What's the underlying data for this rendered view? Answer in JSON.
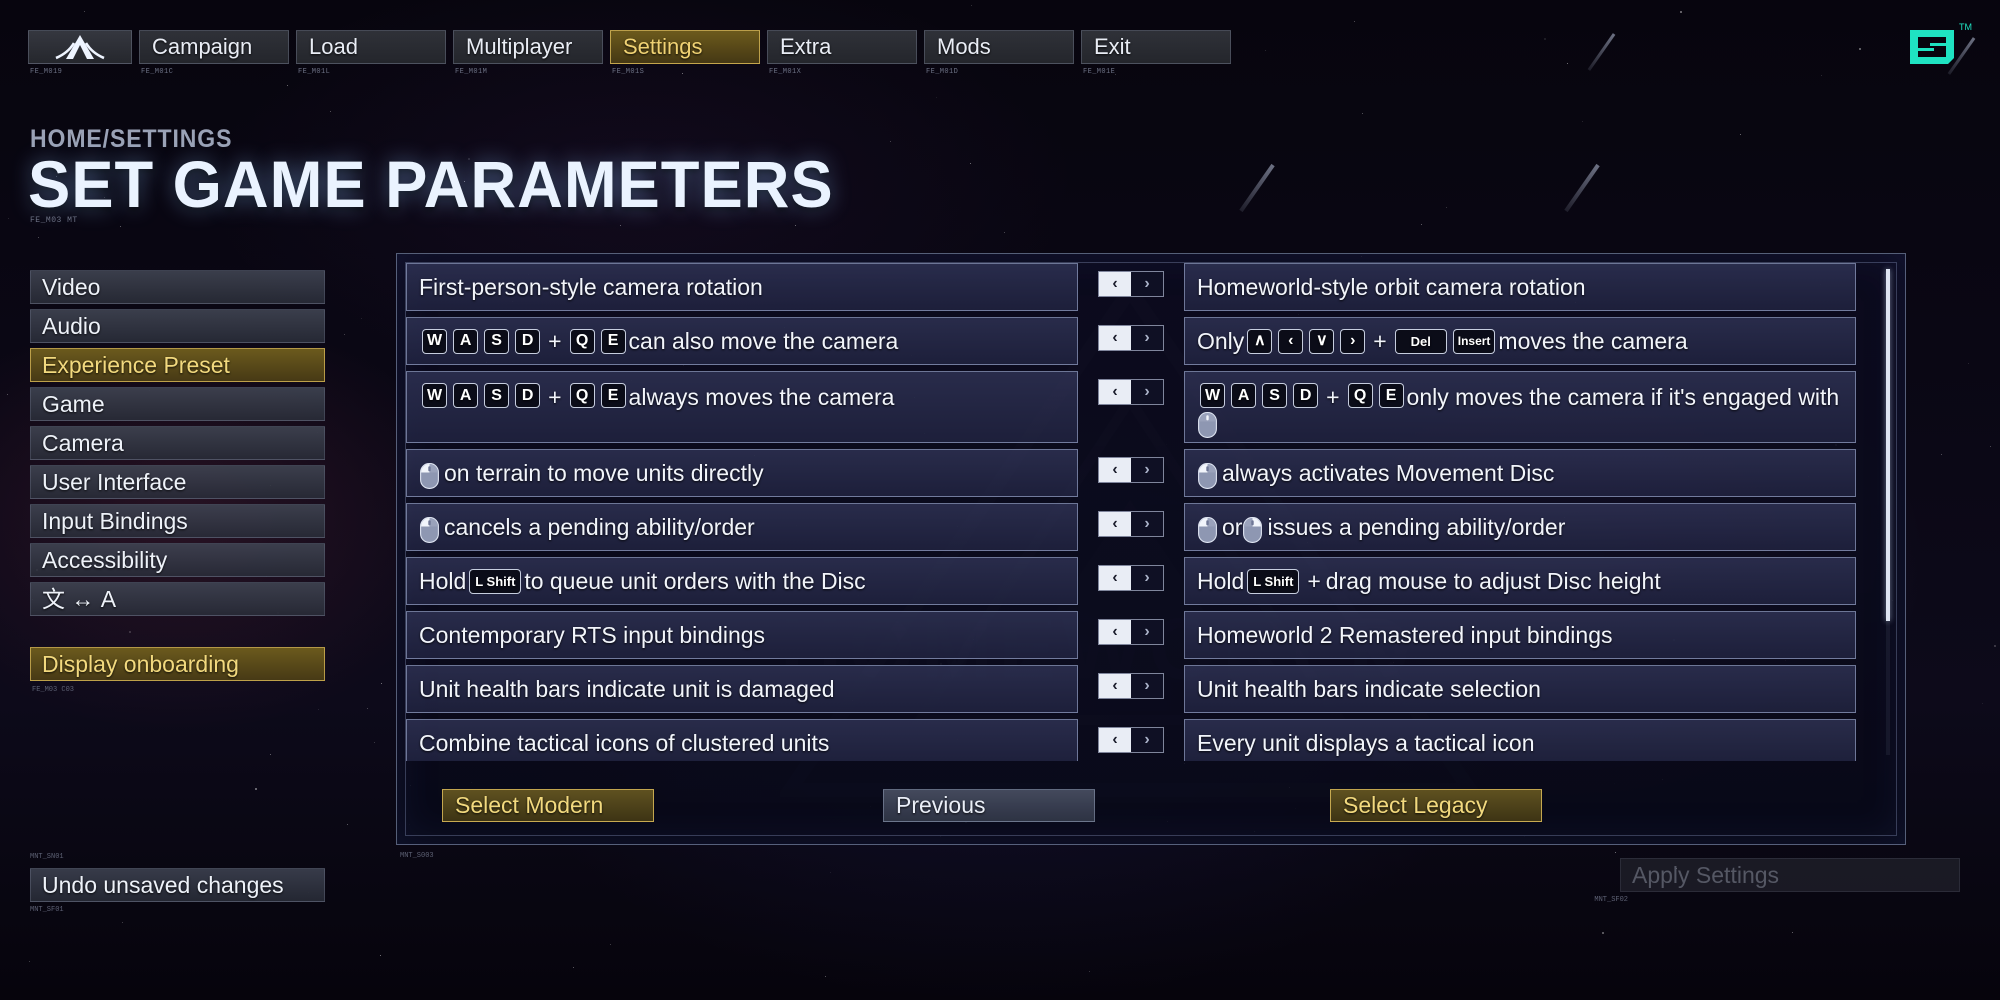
{
  "nav": {
    "logo_code": "FE_M019",
    "items": [
      {
        "label": "Campaign",
        "code": "FE_M01C",
        "active": false
      },
      {
        "label": "Load",
        "code": "FE_M01L",
        "active": false
      },
      {
        "label": "Multiplayer",
        "code": "FE_M01M",
        "active": false
      },
      {
        "label": "Settings",
        "code": "FE_M01S",
        "active": true
      },
      {
        "label": "Extra",
        "code": "FE_M01X",
        "active": false
      },
      {
        "label": "Mods",
        "code": "FE_M01D",
        "active": false
      },
      {
        "label": "Exit",
        "code": "FE_M01E",
        "active": false
      }
    ],
    "brand_tm": "TM"
  },
  "header": {
    "breadcrumb": "HOME/SETTINGS",
    "title": "SET GAME PARAMETERS",
    "code": "FE_M03 MT"
  },
  "sidebar": {
    "items": [
      {
        "label": "Video",
        "active": false
      },
      {
        "label": "Audio",
        "active": false
      },
      {
        "label": "Experience Preset",
        "active": true
      },
      {
        "label": "Game",
        "active": false
      },
      {
        "label": "Camera",
        "active": false
      },
      {
        "label": "User Interface",
        "active": false
      },
      {
        "label": "Input Bindings",
        "active": false
      },
      {
        "label": "Accessibility",
        "active": false
      },
      {
        "label": "文 ↔ A",
        "active": false
      }
    ],
    "onboarding": {
      "label": "Display onboarding",
      "code": "FE_M03 C03"
    }
  },
  "panel": {
    "rows": [
      {
        "left": {
          "segments": [
            {
              "t": "text",
              "v": "First-person-style camera rotation"
            }
          ]
        },
        "right": {
          "segments": [
            {
              "t": "text",
              "v": "Homeworld-style orbit camera rotation"
            }
          ]
        },
        "toggle": {
          "left_glyph": "‹",
          "right_glyph": "›",
          "selected": "left"
        },
        "tall": false
      },
      {
        "left": {
          "segments": [
            {
              "t": "key",
              "v": "W"
            },
            {
              "t": "key",
              "v": "A"
            },
            {
              "t": "key",
              "v": "S"
            },
            {
              "t": "key",
              "v": "D"
            },
            {
              "t": "plus",
              "v": "+"
            },
            {
              "t": "key",
              "v": "Q"
            },
            {
              "t": "key",
              "v": "E"
            },
            {
              "t": "text",
              "v": "can also move the camera"
            }
          ]
        },
        "right": {
          "segments": [
            {
              "t": "text",
              "v": "Only"
            },
            {
              "t": "key",
              "v": "∧"
            },
            {
              "t": "key",
              "v": "‹"
            },
            {
              "t": "key",
              "v": "∨"
            },
            {
              "t": "key",
              "v": "›"
            },
            {
              "t": "plus",
              "v": "+"
            },
            {
              "t": "key-wide",
              "v": "Del"
            },
            {
              "t": "key-sm",
              "v": "Insert"
            },
            {
              "t": "text",
              "v": "moves the camera"
            }
          ]
        },
        "toggle": {
          "left_glyph": "‹",
          "right_glyph": "›",
          "selected": "left"
        },
        "tall": false
      },
      {
        "left": {
          "segments": [
            {
              "t": "key",
              "v": "W"
            },
            {
              "t": "key",
              "v": "A"
            },
            {
              "t": "key",
              "v": "S"
            },
            {
              "t": "key",
              "v": "D"
            },
            {
              "t": "plus",
              "v": "+"
            },
            {
              "t": "key",
              "v": "Q"
            },
            {
              "t": "key",
              "v": "E"
            },
            {
              "t": "text",
              "v": "always moves the camera"
            }
          ]
        },
        "right": {
          "segments": [
            {
              "t": "key",
              "v": "W"
            },
            {
              "t": "key",
              "v": "A"
            },
            {
              "t": "key",
              "v": "S"
            },
            {
              "t": "key",
              "v": "D"
            },
            {
              "t": "plus",
              "v": "+"
            },
            {
              "t": "key",
              "v": "Q"
            },
            {
              "t": "key",
              "v": "E"
            },
            {
              "t": "text",
              "v": "only moves the camera if it's engaged with"
            },
            {
              "t": "mouse",
              "v": "mmb"
            }
          ]
        },
        "toggle": {
          "left_glyph": "‹",
          "right_glyph": "›",
          "selected": "left"
        },
        "tall": true
      },
      {
        "left": {
          "segments": [
            {
              "t": "mouse",
              "v": "lmb"
            },
            {
              "t": "text",
              "v": "on terrain to move units directly"
            }
          ]
        },
        "right": {
          "segments": [
            {
              "t": "mouse",
              "v": "lmb"
            },
            {
              "t": "text",
              "v": "always activates Movement Disc"
            }
          ]
        },
        "toggle": {
          "left_glyph": "‹",
          "right_glyph": "›",
          "selected": "left"
        },
        "tall": false
      },
      {
        "left": {
          "segments": [
            {
              "t": "mouse",
              "v": "lmb"
            },
            {
              "t": "text",
              "v": "cancels a pending ability/order"
            }
          ]
        },
        "right": {
          "segments": [
            {
              "t": "mouse",
              "v": "lmb"
            },
            {
              "t": "text",
              "v": "or"
            },
            {
              "t": "mouse",
              "v": "rmb"
            },
            {
              "t": "text",
              "v": "issues a pending ability/order"
            }
          ]
        },
        "toggle": {
          "left_glyph": "‹",
          "right_glyph": "›",
          "selected": "left"
        },
        "tall": false
      },
      {
        "left": {
          "segments": [
            {
              "t": "text",
              "v": "Hold"
            },
            {
              "t": "key-wide",
              "v": "L Shift"
            },
            {
              "t": "text",
              "v": "to queue unit orders with the Disc"
            }
          ]
        },
        "right": {
          "segments": [
            {
              "t": "text",
              "v": "Hold"
            },
            {
              "t": "key-wide",
              "v": "L Shift"
            },
            {
              "t": "plus",
              "v": "+"
            },
            {
              "t": "text",
              "v": "drag mouse to adjust Disc height"
            }
          ]
        },
        "toggle": {
          "left_glyph": "‹",
          "right_glyph": "›",
          "selected": "left"
        },
        "tall": false
      },
      {
        "left": {
          "segments": [
            {
              "t": "text",
              "v": "Contemporary RTS input bindings"
            }
          ]
        },
        "right": {
          "segments": [
            {
              "t": "text",
              "v": "Homeworld 2 Remastered input bindings"
            }
          ]
        },
        "toggle": {
          "left_glyph": "‹",
          "right_glyph": "›",
          "selected": "left"
        },
        "tall": false
      },
      {
        "left": {
          "segments": [
            {
              "t": "text",
              "v": "Unit health bars indicate unit is damaged"
            }
          ]
        },
        "right": {
          "segments": [
            {
              "t": "text",
              "v": "Unit health bars indicate selection"
            }
          ]
        },
        "toggle": {
          "left_glyph": "‹",
          "right_glyph": "›",
          "selected": "left"
        },
        "tall": false
      },
      {
        "left": {
          "segments": [
            {
              "t": "text",
              "v": "Combine tactical icons of clustered units"
            }
          ]
        },
        "right": {
          "segments": [
            {
              "t": "text",
              "v": "Every unit displays a tactical icon"
            }
          ]
        },
        "toggle": {
          "left_glyph": "‹",
          "right_glyph": "›",
          "selected": "left"
        },
        "tall": false
      }
    ],
    "actions": {
      "select_modern": "Select Modern",
      "previous": "Previous",
      "select_legacy": "Select Legacy"
    },
    "scroll": {
      "thumb_percent": 72
    }
  },
  "footer": {
    "undo": {
      "label": "Undo unsaved changes",
      "code_above": "MNT_SN01",
      "code_below": "MNT_SF01"
    },
    "apply": {
      "label": "Apply Settings",
      "code": "MNT_SF02",
      "enabled": false
    },
    "panel_code": "MNT_S003"
  },
  "colors": {
    "accent_gold": "#f2d97e",
    "panel_border": "#9aaccb",
    "brand_cyan": "#1fe3c2",
    "text": "#eef2f9"
  }
}
